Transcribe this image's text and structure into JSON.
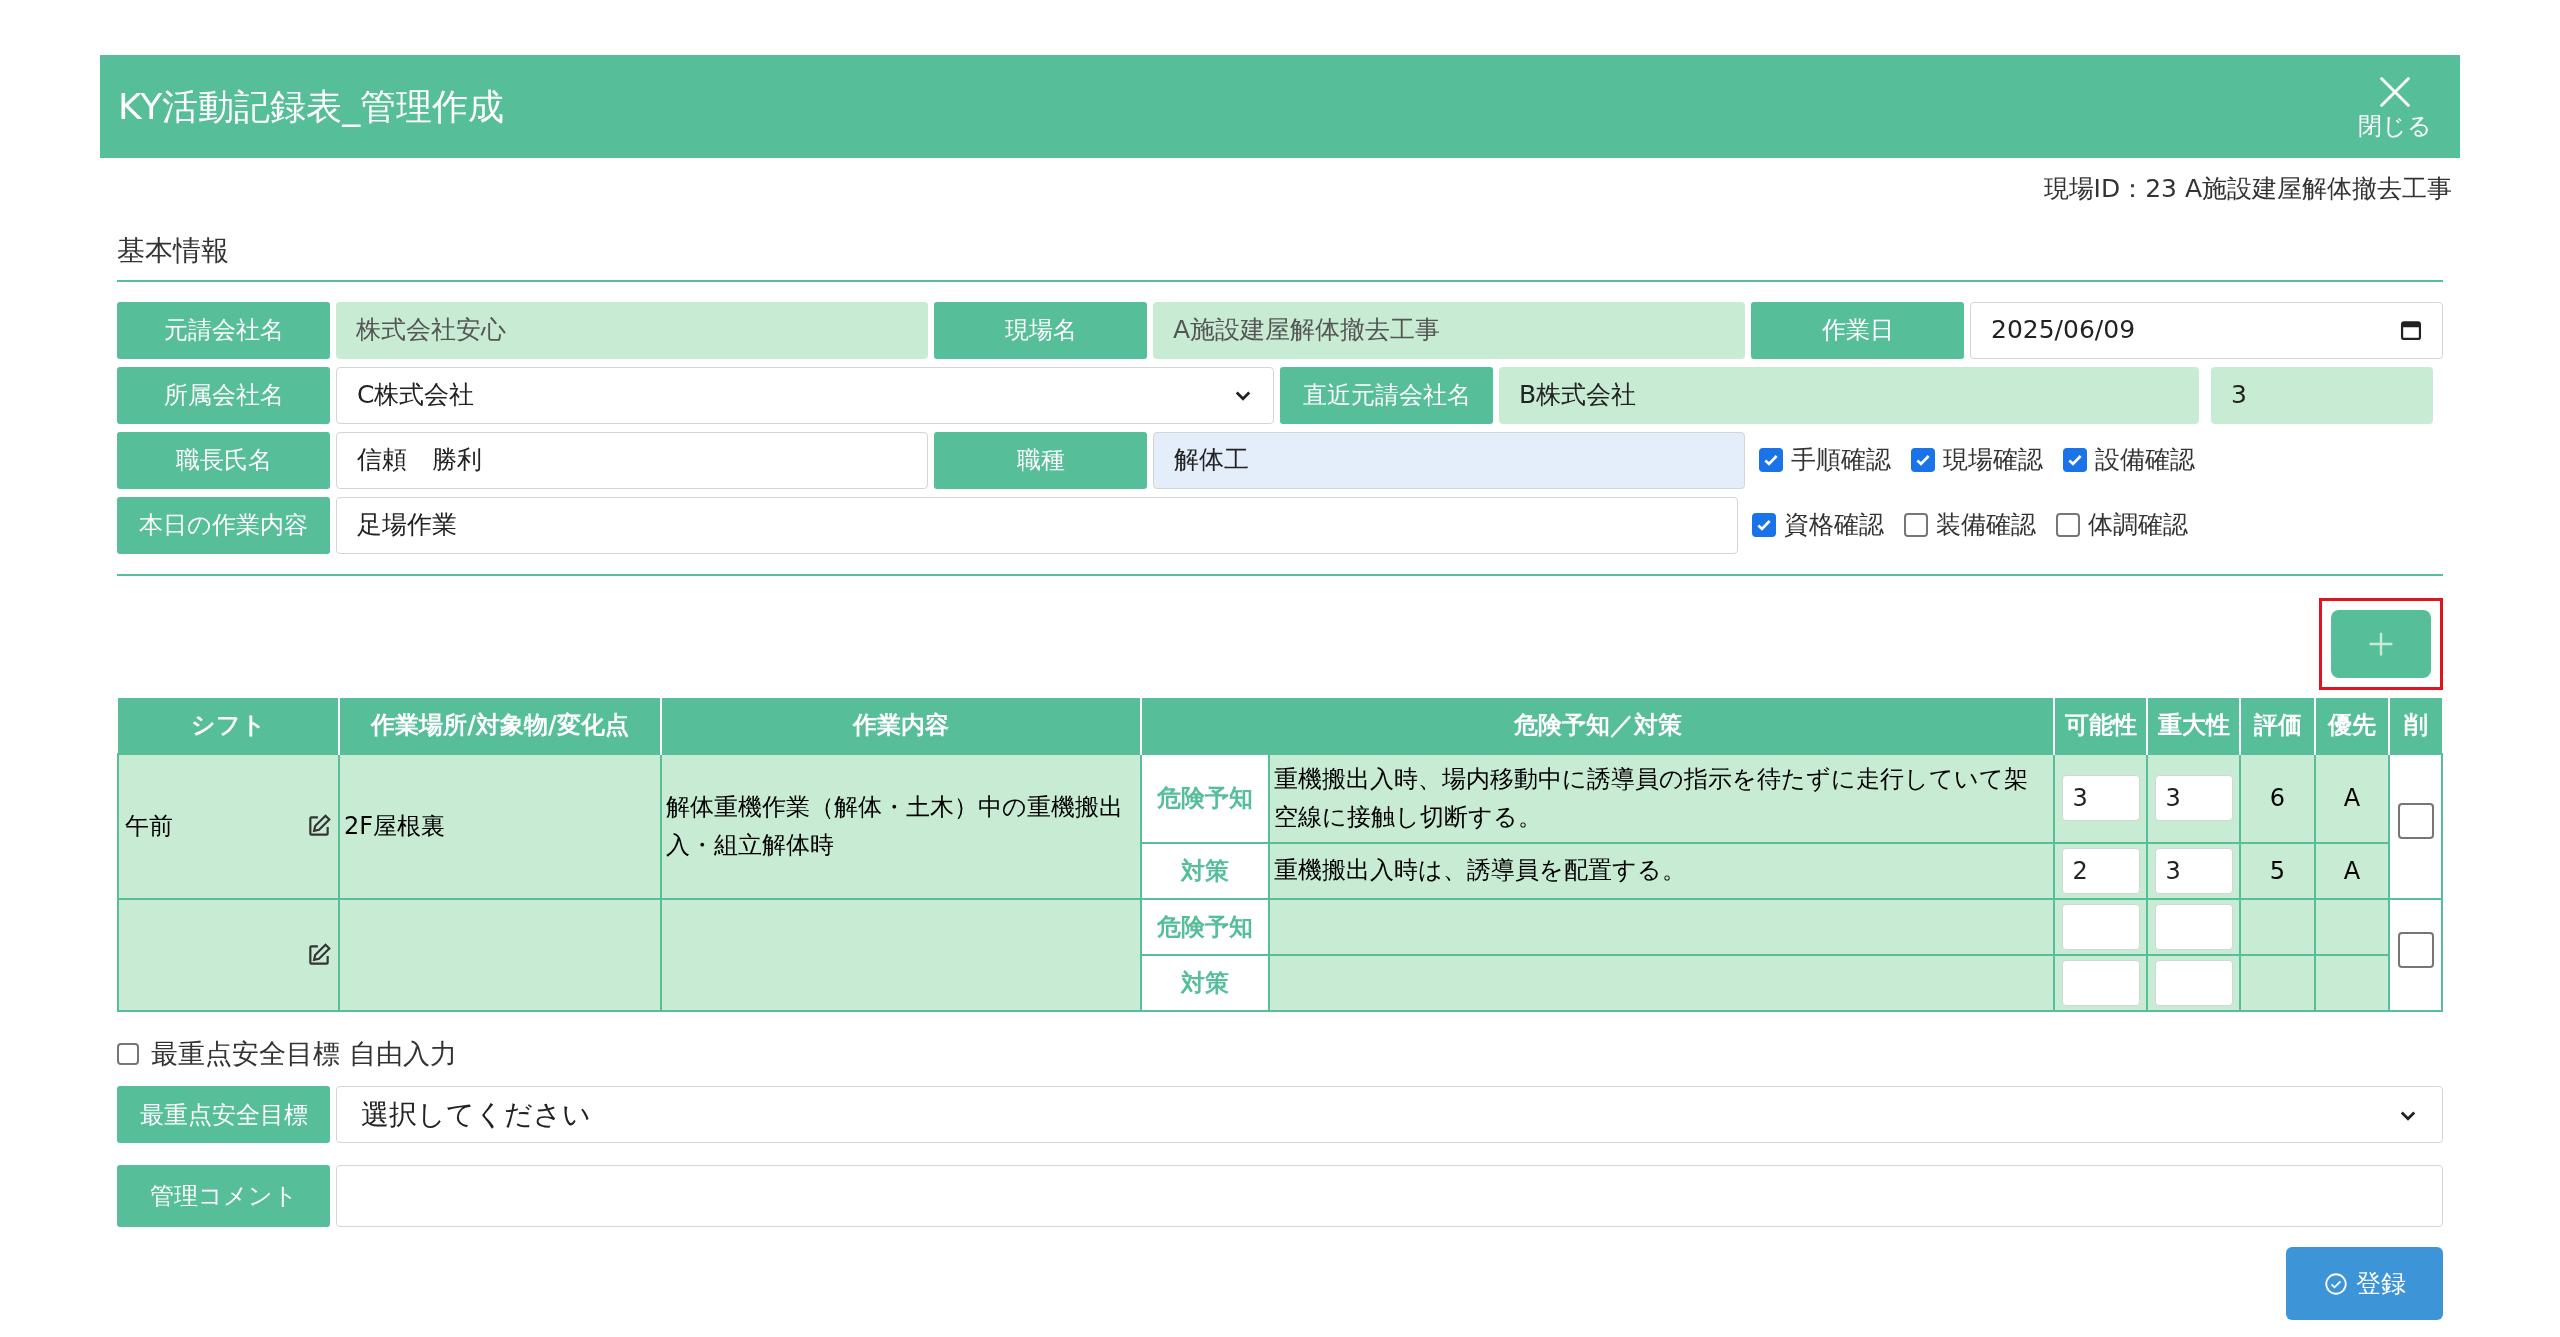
{
  "window": {
    "title": "KY活動記録表_管理作成",
    "close_label": "閉じる"
  },
  "site_id": "現場ID：23 A施設建屋解体撤去工事",
  "section_title": "基本情報",
  "basic_info": {
    "prime_contractor": {
      "label": "元請会社名",
      "value": "株式会社安心"
    },
    "site_name": {
      "label": "現場名",
      "value": "A施設建屋解体撤去工事"
    },
    "work_date": {
      "label": "作業日",
      "value": "2025/06/09"
    },
    "company": {
      "label": "所属会社名",
      "value": "C株式会社"
    },
    "nearest_contractor": {
      "label": "直近元請会社名",
      "value": "B株式会社",
      "value_2": "3"
    },
    "foreman": {
      "label": "職長氏名",
      "value": "信頼　勝利"
    },
    "trade": {
      "label": "職種",
      "value": "解体工"
    },
    "work_content": {
      "label": "本日の作業内容",
      "value": "足場作業"
    },
    "checks": [
      {
        "label": "手順確認",
        "checked": true
      },
      {
        "label": "現場確認",
        "checked": true
      },
      {
        "label": "設備確認",
        "checked": true
      },
      {
        "label": "資格確認",
        "checked": true
      },
      {
        "label": "装備確認",
        "checked": false
      },
      {
        "label": "体調確認",
        "checked": false
      }
    ]
  },
  "table": {
    "columns": [
      "シフト",
      "作業場所/対象物/変化点",
      "作業内容",
      "危険予知／対策",
      "可能性",
      "重大性",
      "評価",
      "優先",
      "削"
    ],
    "rows": [
      {
        "shift": "午前",
        "place": "2F屋根裏",
        "content": "解体重機作業（解体・土木）中の重機搬出入・組立解体時",
        "delete_checked": false,
        "items": [
          {
            "label": "危険予知",
            "text": "重機搬出入時、場内移動中に誘導員の指示を待たずに走行していて架空線に接触し切断する。",
            "possibility": "3",
            "severity": "3",
            "score": "6",
            "priority": "A"
          },
          {
            "label": "対策",
            "text": "重機搬出入時は、誘導員を配置する。",
            "possibility": "2",
            "severity": "3",
            "score": "5",
            "priority": "A"
          }
        ]
      },
      {
        "delete_checked": false,
        "items": [
          {
            "label": "危険予知"
          },
          {
            "label": "対策"
          }
        ]
      }
    ]
  },
  "free_input": {
    "label": "最重点安全目標 自由入力",
    "checked": false
  },
  "safety_goal": {
    "label": "最重点安全目標",
    "value": "選択してください"
  },
  "comment": {
    "label": "管理コメント"
  },
  "submit": "登録"
}
